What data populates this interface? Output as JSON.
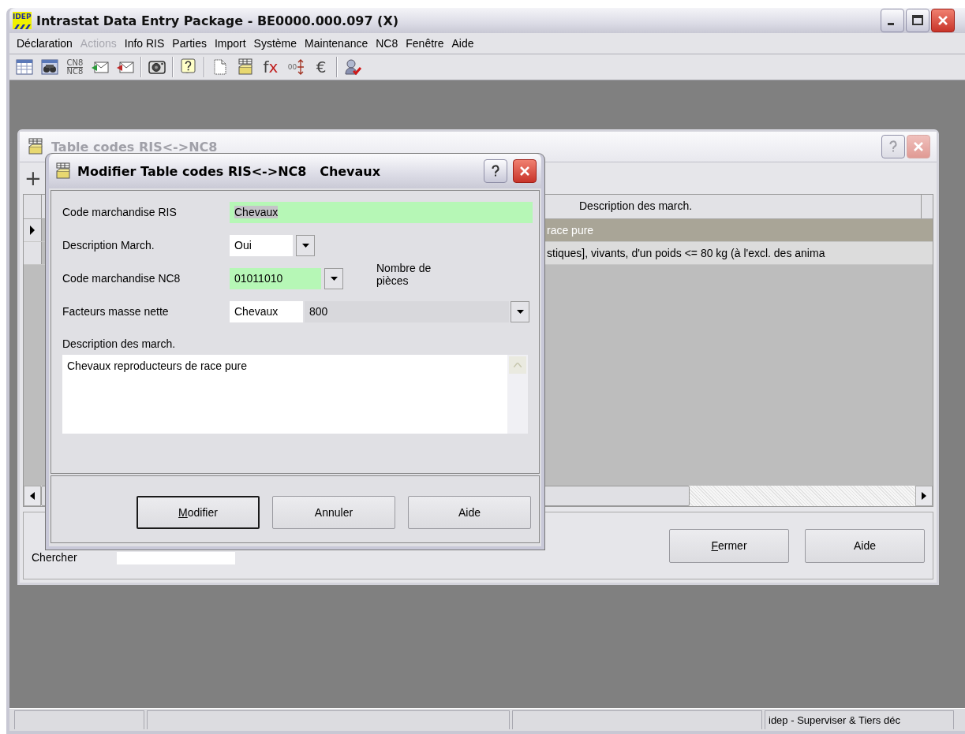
{
  "window": {
    "logo_text": "IDEP",
    "title": "Intrastat Data Entry Package - BE0000.000.097 (X)"
  },
  "menu": [
    {
      "label": "Déclaration",
      "disabled": false
    },
    {
      "label": "Actions",
      "disabled": true
    },
    {
      "label": "Info RIS",
      "disabled": false
    },
    {
      "label": "Parties",
      "disabled": false
    },
    {
      "label": "Import",
      "disabled": false
    },
    {
      "label": "Système",
      "disabled": false
    },
    {
      "label": "Maintenance",
      "disabled": false
    },
    {
      "label": "NC8",
      "disabled": false
    },
    {
      "label": "Fenêtre",
      "disabled": false
    },
    {
      "label": "Aide",
      "disabled": false
    }
  ],
  "toolbar": [
    {
      "kind": "icon"
    },
    {
      "kind": "icon"
    },
    {
      "kind": "stack",
      "top": "CN8",
      "bottom": "NC8"
    },
    {
      "kind": "icon"
    },
    {
      "kind": "icon"
    },
    {
      "kind": "separator"
    },
    {
      "kind": "icon"
    },
    {
      "kind": "separator"
    },
    {
      "kind": "icon"
    },
    {
      "kind": "separator"
    },
    {
      "kind": "icon"
    },
    {
      "kind": "icon"
    },
    {
      "kind": "glyph",
      "text": "fx"
    },
    {
      "kind": "counter",
      "text": "00"
    },
    {
      "kind": "glyph",
      "text": "€"
    },
    {
      "kind": "separator"
    },
    {
      "kind": "icon"
    }
  ],
  "table_window": {
    "title": "Table codes RIS<->NC8",
    "add_button": "+",
    "grid": {
      "columns": [
        {
          "label": "Description des march."
        }
      ],
      "rows": [
        {
          "cells": [
            "race pure"
          ],
          "selected": true
        },
        {
          "cells": [
            "stiques], vivants, d'un poids <= 80 kg (à l'excl. des anima"
          ],
          "selected": false
        }
      ]
    },
    "search": {
      "label": "Chercher"
    },
    "buttons": [
      {
        "label": "Fermer",
        "mnemonic": true
      },
      {
        "label": "Aide",
        "mnemonic": false
      }
    ]
  },
  "dialog": {
    "title": "Modifier Table codes RIS<->NC8   Chevaux",
    "fields": [
      {
        "kind": "text",
        "label": "Code marchandise RIS",
        "value": "Chevaux",
        "required": true,
        "text_selected": true
      },
      {
        "kind": "combo",
        "label": "Description March.",
        "value": "Oui",
        "required": false
      },
      {
        "kind": "combo",
        "label": "Code marchandise NC8",
        "value": "01011010",
        "required": true,
        "note": "Nombre de pièces"
      },
      {
        "kind": "split_combo",
        "label": "Facteurs masse nette",
        "value": "Chevaux",
        "value2": "800",
        "required": false
      }
    ],
    "description_label": "Description des march.",
    "description": "Chevaux reproducteurs de race pure",
    "buttons": [
      {
        "label": "Modifier",
        "mnemonic": true,
        "default": true
      },
      {
        "label": "Annuler",
        "mnemonic": false,
        "default": false
      },
      {
        "label": "Aide",
        "mnemonic": false,
        "default": false
      }
    ]
  },
  "status_bar": {
    "text": "idep - Superviser & Tiers déc"
  }
}
